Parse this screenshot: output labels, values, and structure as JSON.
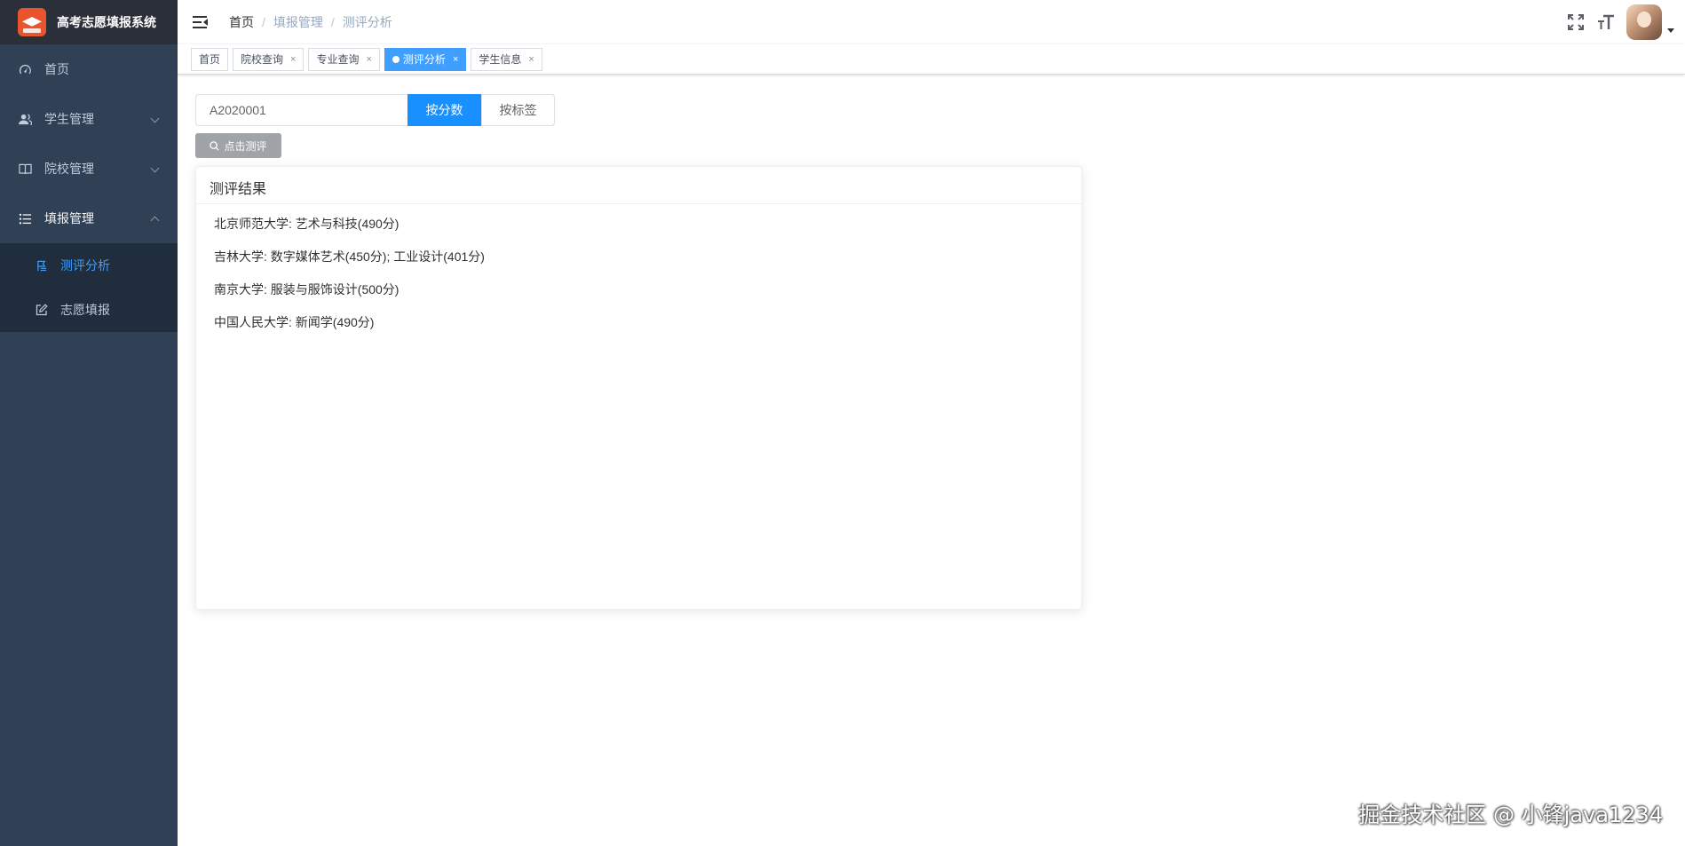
{
  "app": {
    "title": "高考志愿填报系统"
  },
  "sidebar": {
    "items": [
      {
        "label": "首页",
        "icon": "dashboard-icon"
      },
      {
        "label": "学生管理",
        "icon": "user-icon"
      },
      {
        "label": "院校管理",
        "icon": "book-icon"
      },
      {
        "label": "填报管理",
        "icon": "list-icon"
      }
    ],
    "submenu": [
      {
        "label": "测评分析",
        "icon": "flag-icon",
        "active": true
      },
      {
        "label": "志愿填报",
        "icon": "edit-icon"
      }
    ]
  },
  "breadcrumb": [
    "首页",
    "填报管理",
    "测评分析"
  ],
  "tags": [
    {
      "label": "首页"
    },
    {
      "label": "院校查询"
    },
    {
      "label": "专业查询"
    },
    {
      "label": "测评分析",
      "active": true
    },
    {
      "label": "学生信息"
    }
  ],
  "search": {
    "value": "A2020001"
  },
  "toggle": {
    "by_score": "按分数",
    "by_tag": "按标签"
  },
  "eval_button": "点击测评",
  "results": {
    "title": "测评结果",
    "lines": [
      "北京师范大学: 艺术与科技(490分)",
      "吉林大学: 数字媒体艺术(450分); 工业设计(401分)",
      "南京大学: 服装与服饰设计(500分)",
      "中国人民大学: 新闻学(490分)"
    ]
  },
  "watermark": "掘金技术社区 @ 小锋java1234",
  "colors": {
    "sidebar": "#304156",
    "accent": "#409eff",
    "primary": "#1890ff"
  }
}
